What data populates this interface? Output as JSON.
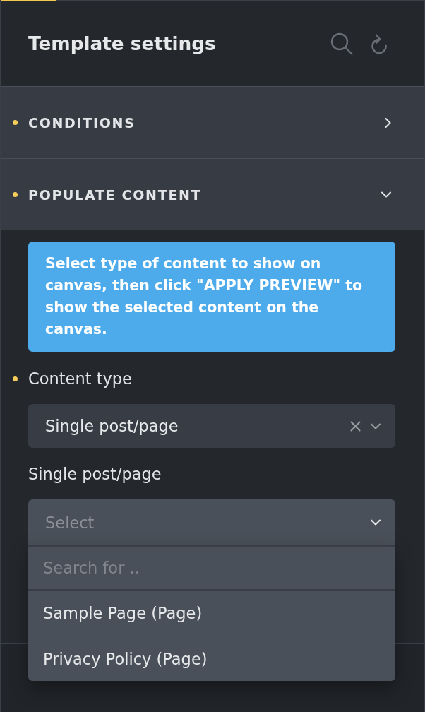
{
  "header": {
    "title": "Template settings"
  },
  "sections": [
    {
      "title": "CONDITIONS",
      "modified": true,
      "expanded": false
    },
    {
      "title": "POPULATE CONTENT",
      "modified": true,
      "expanded": true,
      "info": "Select type of content to show on canvas, then click \"APPLY PREVIEW\" to show the selected content on the canvas.",
      "fields": [
        {
          "label": "Content type",
          "modified": true,
          "value": "Single post/page",
          "open": false
        },
        {
          "label": "Single post/page",
          "modified": false,
          "placeholder": "Select",
          "open": true,
          "search_placeholder": "Search for ..",
          "options": [
            {
              "label": "Sample Page (Page)",
              "selected": false
            },
            {
              "label": "Privacy Policy (Page)",
              "selected": false
            }
          ]
        }
      ]
    }
  ]
}
